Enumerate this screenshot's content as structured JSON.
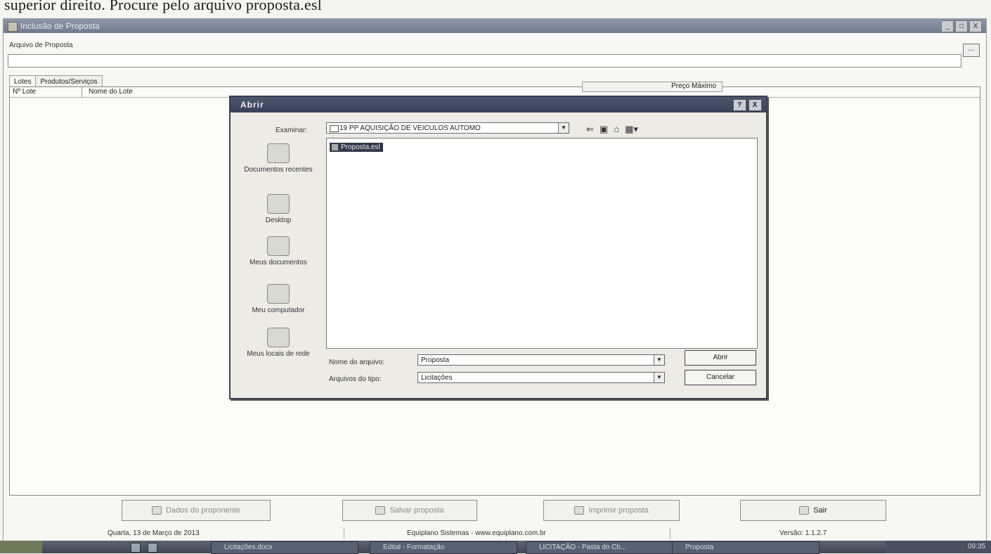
{
  "caption": "superior direito. Procure pelo arquivo proposta.esl",
  "window": {
    "title": "Inclusão de Proposta",
    "controls": [
      "_",
      "□",
      "X"
    ]
  },
  "file_field": {
    "label": "Arquivo de Proposta",
    "value": "",
    "browse_label": "..."
  },
  "tabs": [
    {
      "label": "Lotes"
    },
    {
      "label": "Produtos/Serviços"
    }
  ],
  "grid": {
    "columns": [
      "Nº Lote",
      "Nome do Lote"
    ],
    "right_column": "Preço Máximo"
  },
  "dialog": {
    "title": "Abrir",
    "controls": [
      "?",
      "X"
    ],
    "lookin_label": "Examinar:",
    "lookin_value": "19 PP AQUISIÇÃO DE VEICULOS AUTOMO",
    "places": [
      {
        "label": "Documentos recentes",
        "icon": "recent-documents-icon"
      },
      {
        "label": "Desktop",
        "icon": "desktop-icon"
      },
      {
        "label": "Meus documentos",
        "icon": "my-documents-icon"
      },
      {
        "label": "Meu computador",
        "icon": "my-computer-icon"
      },
      {
        "label": "Meus locais de rede",
        "icon": "network-places-icon"
      }
    ],
    "files": [
      {
        "name": "Proposta.esl",
        "selected": true
      }
    ],
    "filename_label": "Nome do arquivo:",
    "filename_value": "Proposta",
    "filetype_label": "Arquivos do tipo:",
    "filetype_value": "Licitações",
    "open_label": "Abrir",
    "cancel_label": "Cancelar"
  },
  "buttons": [
    {
      "label": "Dados do proponente",
      "enabled": false,
      "icon": "user-icon"
    },
    {
      "label": "Salvar proposta",
      "enabled": false,
      "icon": "save-icon"
    },
    {
      "label": "Imprimir proposta",
      "enabled": false,
      "icon": "print-icon"
    },
    {
      "label": "Sair",
      "enabled": true,
      "icon": "exit-icon"
    }
  ],
  "status": {
    "date": "Quarta, 13 de Março de 2013",
    "company": "Equiplano Sistemas - www.equiplano.com.br",
    "version": "Versão: 1.1.2.7"
  },
  "taskbar": {
    "items": [
      "Licitações.docx",
      "Edital - Formatação",
      "LICITAÇÃO - Pasta do Ch...",
      "Proposta"
    ],
    "clock": "09:35"
  }
}
